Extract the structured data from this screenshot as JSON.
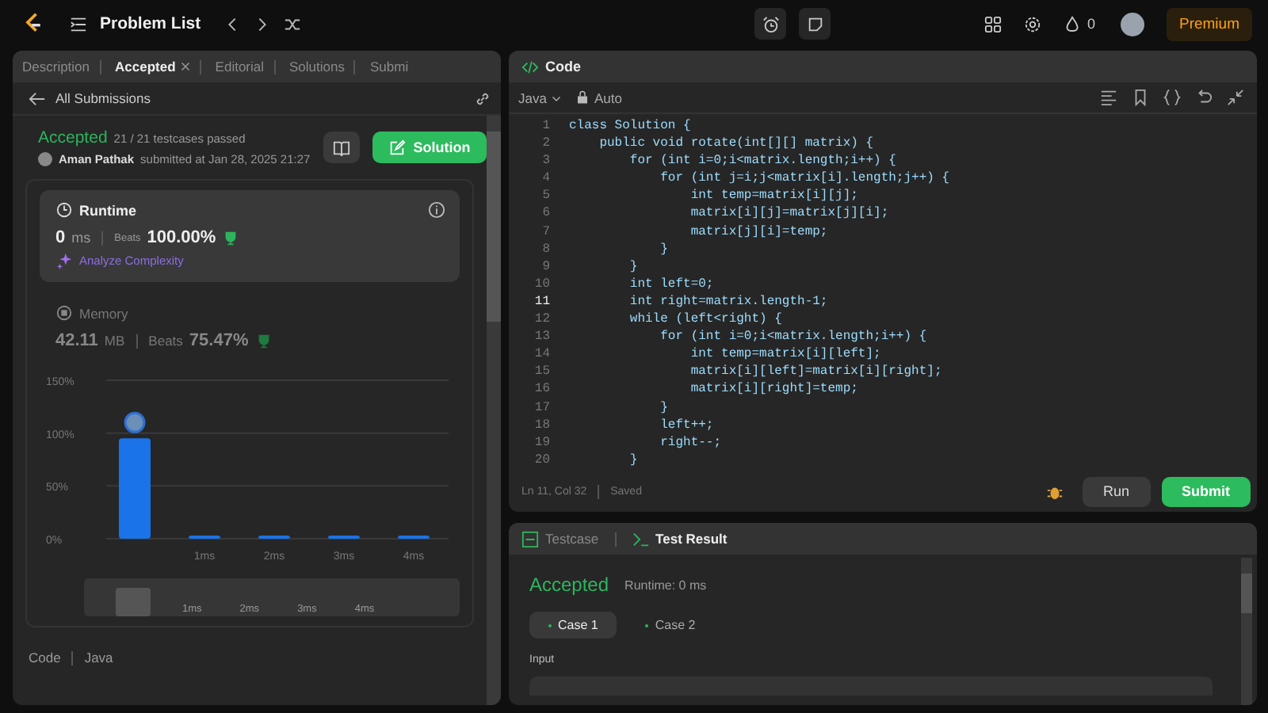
{
  "top_bar": {
    "title": "Problem List",
    "streak": "0",
    "premium": "Premium"
  },
  "left_tabs": [
    {
      "label": "Description",
      "selected": false,
      "closable": false
    },
    {
      "label": "Accepted",
      "selected": true,
      "closable": true
    },
    {
      "label": "Editorial",
      "selected": false,
      "closable": false
    },
    {
      "label": "Solutions",
      "selected": false,
      "closable": false
    },
    {
      "label": "Submi",
      "selected": false,
      "closable": false
    }
  ],
  "back_link": "All Submissions",
  "submission": {
    "status": "Accepted",
    "testcases": "21 / 21 testcases passed",
    "author": "Aman Pathak",
    "submitted": "submitted at Jan 28, 2025 21:27",
    "solution_button": "Solution"
  },
  "runtime": {
    "title": "Runtime",
    "value": "0",
    "unit": "ms",
    "beats_label": "Beats",
    "beats": "100.00%",
    "analyze": "Analyze Complexity"
  },
  "memory": {
    "title": "Memory",
    "value": "42.11",
    "unit": "MB",
    "beats_label": "Beats",
    "beats": "75.47%"
  },
  "chart_data": {
    "type": "bar",
    "categories": [
      null,
      "1ms",
      "2ms",
      "3ms",
      "4ms"
    ],
    "values": [
      95,
      3,
      3,
      3,
      3
    ],
    "ylim": [
      0,
      150
    ],
    "yticks": [
      {
        "value": 0,
        "label": "0%"
      },
      {
        "value": 50,
        "label": "50%"
      },
      {
        "value": 100,
        "label": "100%"
      },
      {
        "value": 150,
        "label": "150%"
      }
    ]
  },
  "brush_labels": [
    "1ms",
    "2ms",
    "3ms",
    "4ms"
  ],
  "code_footer": {
    "label": "Code",
    "language": "Java"
  },
  "editor": {
    "title": "Code",
    "language": "Java",
    "mode": "Auto",
    "lines": [
      {
        "number": "1",
        "text": "class Solution {",
        "current": false
      },
      {
        "number": "2",
        "text": "    public void rotate(int[][] matrix) {",
        "current": false
      },
      {
        "number": "3",
        "text": "        for (int i=0;i<matrix.length;i++) {",
        "current": false
      },
      {
        "number": "4",
        "text": "            for (int j=i;j<matrix[i].length;j++) {",
        "current": false
      },
      {
        "number": "5",
        "text": "                int temp=matrix[i][j];",
        "current": false
      },
      {
        "number": "6",
        "text": "                matrix[i][j]=matrix[j][i];",
        "current": false
      },
      {
        "number": "7",
        "text": "                matrix[j][i]=temp;",
        "current": false
      },
      {
        "number": "8",
        "text": "            }",
        "current": false
      },
      {
        "number": "9",
        "text": "        }",
        "current": false
      },
      {
        "number": "10",
        "text": "        int left=0;",
        "current": false
      },
      {
        "number": "11",
        "text": "        int right=matrix.length-1;",
        "current": true
      },
      {
        "number": "12",
        "text": "        while (left<right) {",
        "current": false
      },
      {
        "number": "13",
        "text": "            for (int i=0;i<matrix.length;i++) {",
        "current": false
      },
      {
        "number": "14",
        "text": "                int temp=matrix[i][left];",
        "current": false
      },
      {
        "number": "15",
        "text": "                matrix[i][left]=matrix[i][right];",
        "current": false
      },
      {
        "number": "16",
        "text": "                matrix[i][right]=temp;",
        "current": false
      },
      {
        "number": "17",
        "text": "            }",
        "current": false
      },
      {
        "number": "18",
        "text": "            left++;",
        "current": false
      },
      {
        "number": "19",
        "text": "            right--;",
        "current": false
      },
      {
        "number": "20",
        "text": "        }",
        "current": false
      }
    ],
    "position": "Ln 11, Col 32",
    "saved": "Saved"
  },
  "run_button": "Run",
  "submit_button": "Submit",
  "result_tabs": [
    {
      "label": "Testcase",
      "selected": false
    },
    {
      "label": "Test Result",
      "selected": true
    }
  ],
  "result": {
    "status": "Accepted",
    "runtime": "Runtime: 0 ms",
    "cases": [
      {
        "label": "Case 1",
        "selected": true
      },
      {
        "label": "Case 2",
        "selected": false
      }
    ],
    "input_label": "Input"
  }
}
